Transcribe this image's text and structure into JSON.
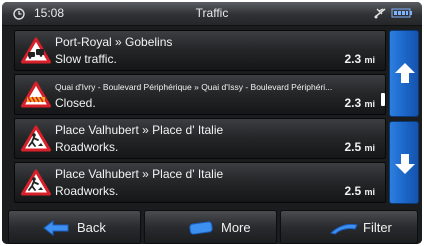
{
  "status_bar": {
    "time": "15:08",
    "title": "Traffic",
    "icons": [
      "clock-icon",
      "gps-signal-icon",
      "battery-icon"
    ]
  },
  "traffic_items": [
    {
      "route": "Port-Royal » Gobelins",
      "description": "Slow traffic.",
      "distance": "2.3",
      "unit": "mi",
      "icon": "slow-traffic-warning-icon"
    },
    {
      "route": "Quai d'Ivry - Boulevard Périphérique » Quai d'Issy - Boulevard Périphéri...",
      "description": "Closed.",
      "distance": "2.3",
      "unit": "mi",
      "icon": "road-closed-warning-icon"
    },
    {
      "route": "Place Valhubert » Place d' Italie",
      "description": "Roadworks.",
      "distance": "2.5",
      "unit": "mi",
      "icon": "roadworks-warning-icon"
    },
    {
      "route": "Place Valhubert » Place d' Italie",
      "description": "Roadworks.",
      "distance": "2.5",
      "unit": "mi",
      "icon": "roadworks-warning-icon"
    }
  ],
  "bottom_bar": {
    "back_label": "Back",
    "more_label": "More",
    "filter_label": "Filter"
  },
  "colors": {
    "accent_blue": "#1a63c4",
    "warning_red": "#d8202a",
    "background": "#1b1c1e"
  }
}
